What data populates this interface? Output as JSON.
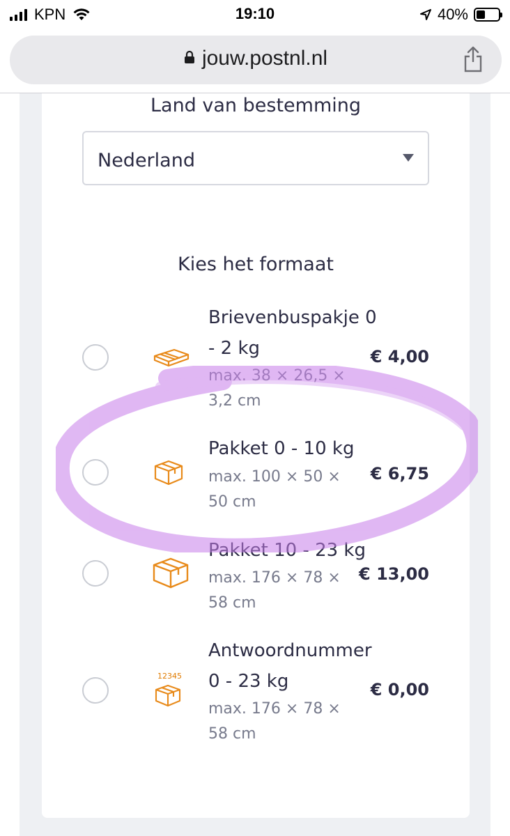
{
  "status_bar": {
    "carrier": "KPN",
    "time": "19:10",
    "battery": "40%",
    "battery_level": 0.4
  },
  "browser": {
    "url": "jouw.postnl.nl"
  },
  "destination": {
    "label": "Land van bestemming",
    "value": "Nederland"
  },
  "format": {
    "title": "Kies het formaat",
    "options": [
      {
        "name": "Brievenbuspakje 0 - 2 kg",
        "dims": "max. 38 × 26,5 × 3,2 cm",
        "price": "€ 4,00",
        "icon": "letterbox-parcel-icon"
      },
      {
        "name": "Pakket 0 - 10 kg",
        "dims": "max. 100 × 50 × 50 cm",
        "price": "€ 6,75",
        "icon": "package-small-icon"
      },
      {
        "name": "Pakket 10 - 23 kg",
        "dims": "max. 176 × 78 × 58 cm",
        "price": "€ 13,00",
        "icon": "package-large-icon"
      },
      {
        "name": "Antwoordnummer 0 - 23 kg",
        "dims": "max. 176 × 78 × 58 cm",
        "price": "€ 0,00",
        "icon": "reply-number-package-icon",
        "code": "12345"
      }
    ]
  },
  "colors": {
    "icon_orange": "#e88a1a",
    "text_dark": "#2c2c44",
    "text_muted": "#777a8c",
    "highlight": "#c77dea"
  }
}
